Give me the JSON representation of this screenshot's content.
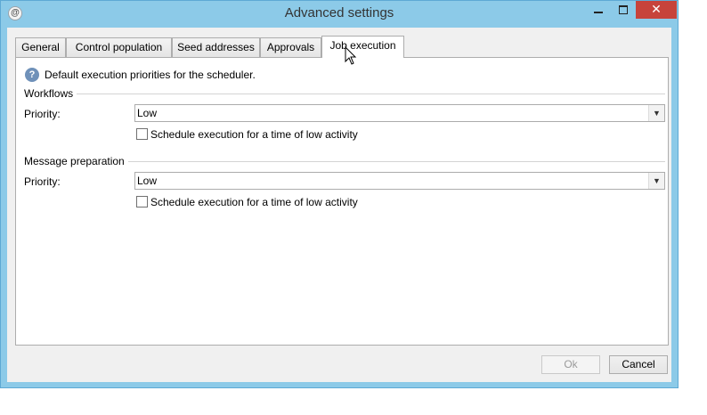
{
  "window": {
    "title": "Advanced settings",
    "close_glyph": "✕"
  },
  "tabs": [
    {
      "label": "General"
    },
    {
      "label": "Control population"
    },
    {
      "label": "Seed addresses"
    },
    {
      "label": "Approvals"
    },
    {
      "label": "Job execution",
      "selected": true
    }
  ],
  "info": {
    "icon": "question-circle-icon",
    "text": "Default execution priorities for the scheduler."
  },
  "workflows": {
    "group_label": "Workflows",
    "priority_label": "Priority:",
    "priority_value": "Low",
    "checkbox_label": "Schedule execution for a time of low activity",
    "checked": false
  },
  "message_preparation": {
    "group_label": "Message preparation",
    "priority_label": "Priority:",
    "priority_value": "Low",
    "checkbox_label": "Schedule execution for a time of low activity",
    "checked": false
  },
  "buttons": {
    "ok_label": "Ok",
    "cancel_label": "Cancel",
    "ok_enabled": false
  },
  "colors": {
    "titlebar": "#8ccae8",
    "close_button": "#c7433b",
    "dialog_bg": "#f0f0f0",
    "info_icon": "#6f91b9"
  }
}
